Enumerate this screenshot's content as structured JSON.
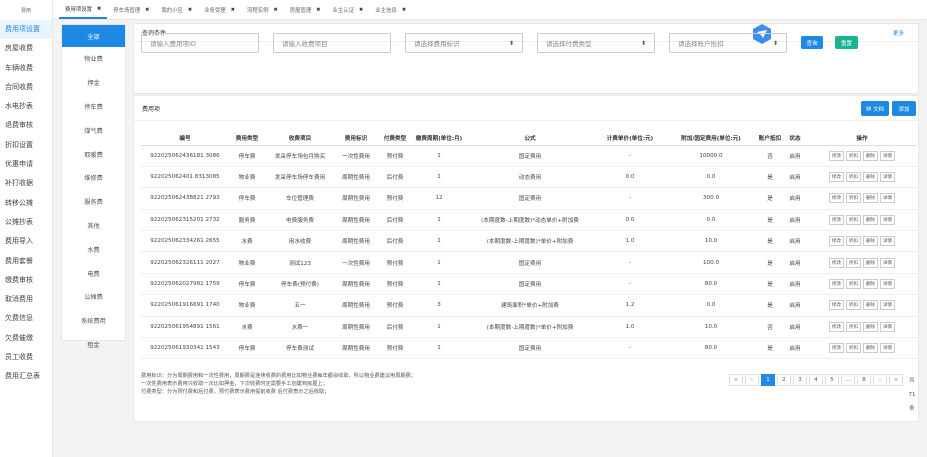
{
  "sidebar": {
    "logo": "费用",
    "items": [
      "费用项设置",
      "房屋收费",
      "车辆收费",
      "合同收费",
      "水电抄表",
      "退费审核",
      "折扣设置",
      "优惠申请",
      "补打收据",
      "转移公摊",
      "公摊抄表",
      "费用导入",
      "费用套餐",
      "缴费审核",
      "取消费用",
      "欠费信息",
      "欠费催缴",
      "员工收费",
      "费用汇总表"
    ]
  },
  "tabs": [
    {
      "label": "费用项设置",
      "active": true
    },
    {
      "label": "停车场管理"
    },
    {
      "label": "我的小区"
    },
    {
      "label": "业务受理"
    },
    {
      "label": "流程实例"
    },
    {
      "label": "房屋管理"
    },
    {
      "label": "业主认证"
    },
    {
      "label": "业主信息"
    }
  ],
  "categories": [
    "全部",
    "物业费",
    "押金",
    "停车费",
    "煤气费",
    "取暖费",
    "维修费",
    "服务费",
    "其他",
    "水费",
    "电费",
    "公摊费",
    "系统费用",
    "租金"
  ],
  "query": {
    "title": "查询条件",
    "more": "更多",
    "fee_id_placeholder": "请输入费用项ID",
    "fee_item_placeholder": "请输入收费项目",
    "fee_flag": "请选择费用标识",
    "pay_type": "请选择付费类型",
    "account_deduct": "请选择账户抵扣",
    "search": "查询",
    "reset": "重置"
  },
  "table_card": {
    "title": "费用项",
    "doc": "文档",
    "add": "添加",
    "columns": [
      "编号",
      "费用类型",
      "收费项目",
      "费用标识",
      "付费类型",
      "缴费周期(单位:月)",
      "公式",
      "计费单价(单位:元)",
      "附加/固定费用(单位:元)",
      "账户抵扣",
      "状态",
      "操作"
    ],
    "ops": [
      "修改",
      "折扣",
      "删除",
      "详情"
    ],
    "rows": [
      [
        "922025062436181 3086",
        "停车费",
        "发采停车场包月购买",
        "一次性费用",
        "预付费",
        "1",
        "固定费用",
        "-",
        "10000.0",
        "否",
        "启用"
      ],
      [
        "922025062401 8313085",
        "物业费",
        "发采停车场停车费用",
        "周期性费用",
        "后付费",
        "1",
        "动态费用",
        "0.0",
        "0.0",
        "是",
        "启用"
      ],
      [
        "922025062438821 2793",
        "停车费",
        "车位管理费",
        "周期性费用",
        "预付费",
        "12",
        "固定费用",
        "-",
        "300.0",
        "是",
        "启用"
      ],
      [
        "922025062315201 2732",
        "服务费",
        "电费服务费",
        "周期性费用",
        "后付费",
        "1",
        "(本期度数-上期度数)*动态单价+附加费",
        "0.0",
        "0.0",
        "是",
        "启用"
      ],
      [
        "922025062334261 2655",
        "水费",
        "用水收费",
        "周期性费用",
        "后付费",
        "1",
        "(本期度数-上期度数)*单价+附加费",
        "1.0",
        "10.0",
        "是",
        "启用"
      ],
      [
        "922025062326111 2027",
        "物业费",
        "测试123",
        "一次性费用",
        "预付费",
        "1",
        "固定费用",
        "-",
        "100.0",
        "是",
        "启用"
      ],
      [
        "922025062027981 1759",
        "停车费",
        "停车费(预付费)",
        "周期性费用",
        "预付费",
        "1",
        "固定费用",
        "-",
        "80.0",
        "是",
        "启用"
      ],
      [
        "922025061916691 1740",
        "物业费",
        "五一",
        "周期性费用",
        "预付费",
        "3",
        "建筑面积*单价+附加费",
        "1.2",
        "0.0",
        "是",
        "启用"
      ],
      [
        "922025061954891 1561",
        "水费",
        "水费一",
        "周期性费用",
        "后付费",
        "1",
        "(本期度数-上期度数)*单价+附加费",
        "1.0",
        "10.0",
        "否",
        "启用"
      ],
      [
        "922025061930341 1543",
        "停车费",
        "停车费测试",
        "周期性费用",
        "预付费",
        "1",
        "固定费用",
        "-",
        "80.0",
        "是",
        "启用"
      ]
    ]
  },
  "notes": [
    "费用标识：分为周期费用和一次性费用，周期费是连续收费的费用比如物业费每年都会收取，所以物业费建议用周期费；",
    "一次性费用表示费用只收取一次比如押金，下次收费时还需要手工创建到房屋上；",
    "付费类型：分为预付费和后付费，预付费表示费用提前收费 后付费表示之后收取；"
  ],
  "pager": {
    "pages": [
      "«",
      "‹",
      "1",
      "2",
      "3",
      "4",
      "5",
      "...",
      "8",
      "›",
      "»"
    ],
    "current": "1",
    "total": [
      "共",
      "71",
      "条"
    ]
  },
  "colors": {
    "primary": "#1e88e5",
    "reset": "#1ab394"
  }
}
